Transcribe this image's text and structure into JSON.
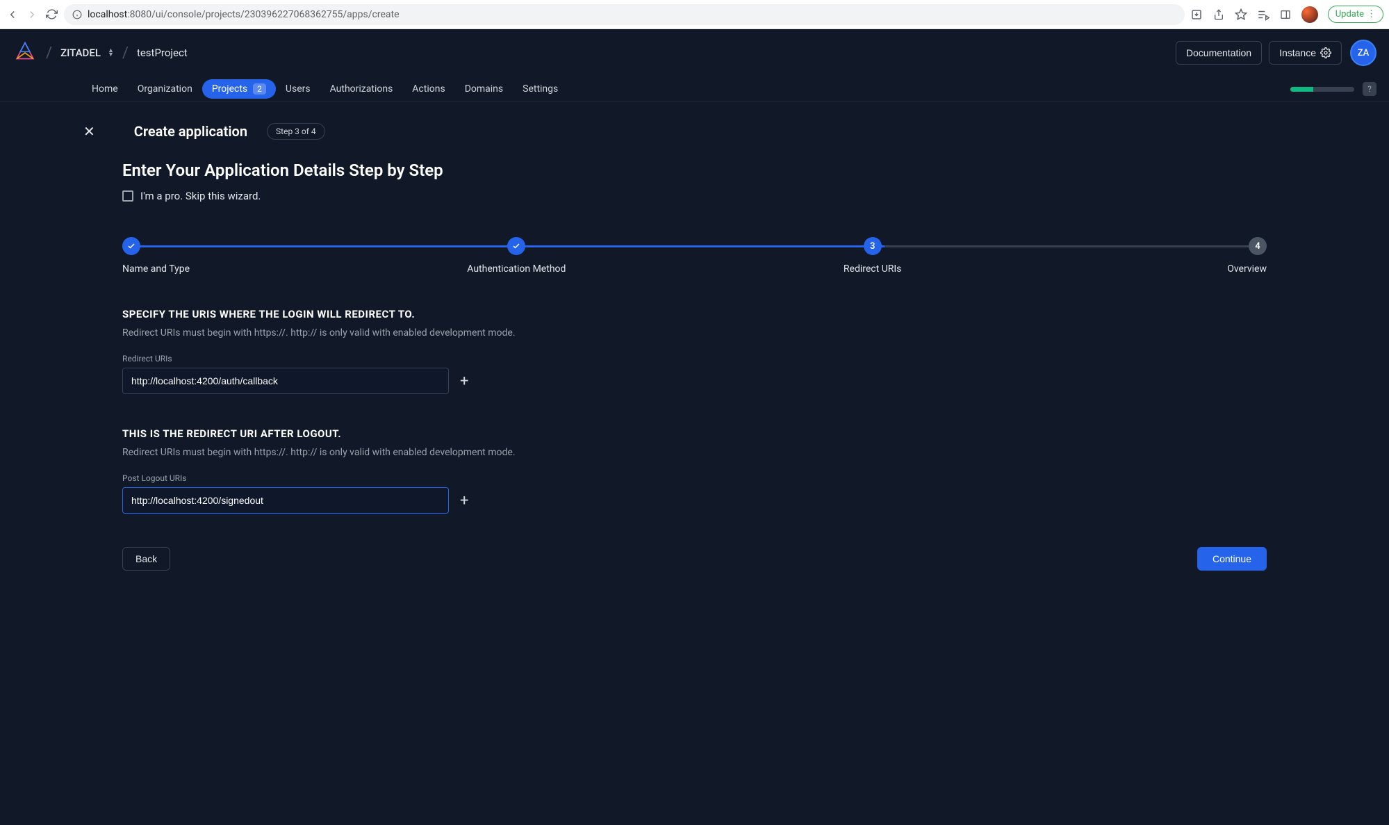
{
  "browser": {
    "url_host": "localhost",
    "url_port_path": ":8080/ui/console/projects/230396227068362755/apps/create",
    "update_label": "Update"
  },
  "header": {
    "org": "ZITADEL",
    "project": "testProject",
    "doc_btn": "Documentation",
    "instance_btn": "Instance",
    "avatar_initials": "ZA"
  },
  "tabs": {
    "home": "Home",
    "organization": "Organization",
    "projects": "Projects",
    "projects_count": "2",
    "users": "Users",
    "authorizations": "Authorizations",
    "actions": "Actions",
    "domains": "Domains",
    "settings": "Settings",
    "help": "?"
  },
  "page": {
    "title": "Create application",
    "step_pill": "Step 3 of 4",
    "subtitle": "Enter Your Application Details Step by Step",
    "skip_label": "I'm a pro. Skip this wizard."
  },
  "stepper": {
    "s1": "Name and Type",
    "s2": "Authentication Method",
    "s3": "Redirect URIs",
    "s3_num": "3",
    "s4": "Overview",
    "s4_num": "4"
  },
  "form": {
    "redirect_title": "SPECIFY THE URIS WHERE THE LOGIN WILL REDIRECT TO.",
    "redirect_desc": "Redirect URIs must begin with https://. http:// is only valid with enabled development mode.",
    "redirect_label": "Redirect URIs",
    "redirect_value": "http://localhost:4200/auth/callback",
    "logout_title": "THIS IS THE REDIRECT URI AFTER LOGOUT.",
    "logout_desc": "Redirect URIs must begin with https://. http:// is only valid with enabled development mode.",
    "logout_label": "Post Logout URIs",
    "logout_value": "http://localhost:4200/signedout"
  },
  "footer": {
    "back": "Back",
    "continue": "Continue"
  }
}
